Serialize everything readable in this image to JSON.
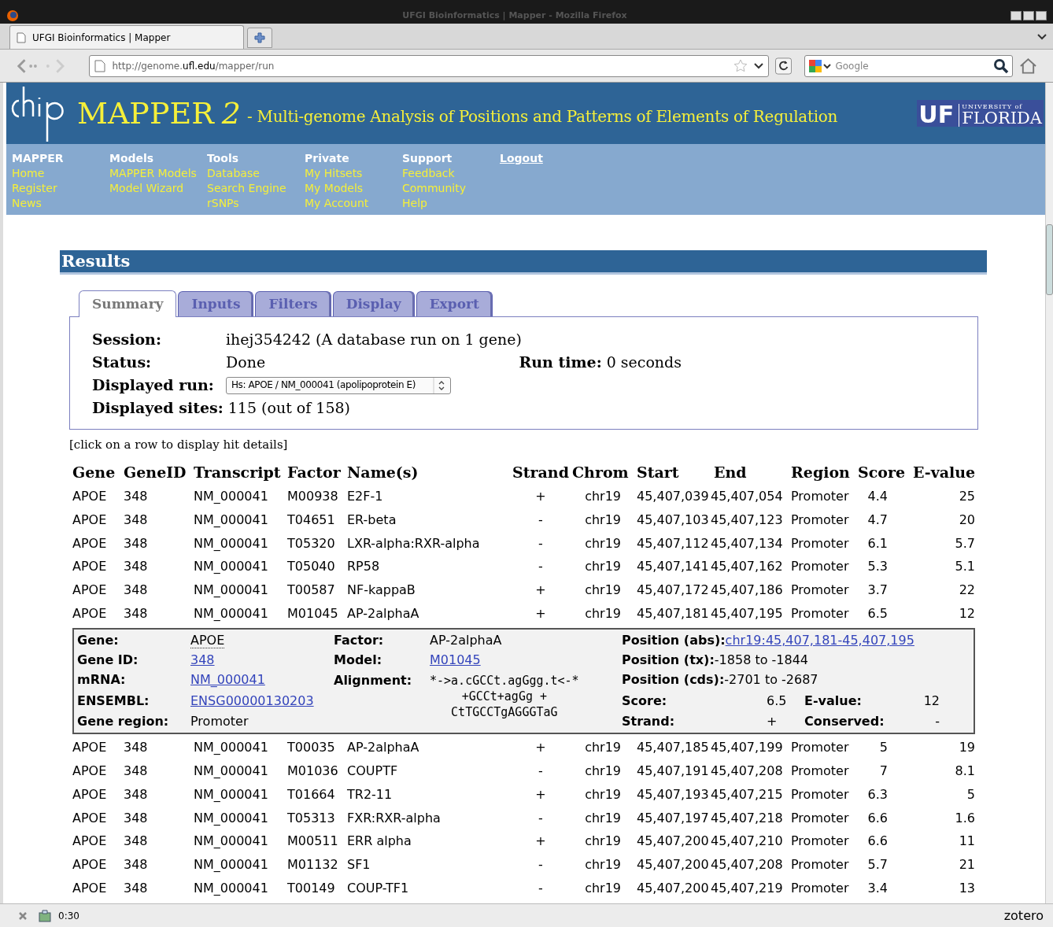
{
  "browser": {
    "window_title": "UFGI Bioinformatics | Mapper - Mozilla Firefox",
    "tab_title": "UFGI Bioinformatics | Mapper",
    "url_parts": [
      "http://genome.",
      "ufl.edu",
      "/mapper/run"
    ],
    "search_placeholder": "Google"
  },
  "header": {
    "title": "MAPPER",
    "version": "2",
    "subtitle": "- Multi-genome Analysis of Positions and Patterns of Elements of Regulation",
    "uf": "UF",
    "university": "UNIVERSITY of",
    "florida": "FLORIDA"
  },
  "menu": [
    {
      "heading": "MAPPER",
      "items": [
        "Home",
        "Register",
        "News"
      ]
    },
    {
      "heading": "Models",
      "items": [
        "MAPPER Models",
        "Model Wizard"
      ]
    },
    {
      "heading": "Tools",
      "items": [
        "Database",
        "Search Engine",
        "rSNPs"
      ]
    },
    {
      "heading": "Private",
      "items": [
        "My Hitsets",
        "My Models",
        "My Account"
      ]
    },
    {
      "heading": "Support",
      "items": [
        "Feedback",
        "Community",
        "Help"
      ]
    },
    {
      "heading": "Logout",
      "kind": "link"
    }
  ],
  "results": {
    "title": "Results",
    "tabs": [
      {
        "label": "Summary",
        "selected": true
      },
      {
        "label": "Inputs",
        "selected": false
      },
      {
        "label": "Filters",
        "selected": false
      },
      {
        "label": "Display",
        "selected": false
      },
      {
        "label": "Export",
        "selected": false
      }
    ],
    "session": {
      "label": "Session:",
      "value": "ihej354242 (A database run on 1 gene)"
    },
    "status": {
      "label": "Status:",
      "value": "Done"
    },
    "run_time": {
      "label": "Run time:",
      "value": "0 seconds"
    },
    "displayed_run": {
      "label": "Displayed run:",
      "value": "Hs: APOE / NM_000041 (apolipoprotein E)"
    },
    "displayed_sites": {
      "label": "Displayed sites:",
      "value": "115 (out of 158)"
    },
    "hint": "[click on a row to display hit details]",
    "table": {
      "columns": [
        "Gene",
        "GeneID",
        "Transcript",
        "Factor",
        "Name(s)",
        "Strand",
        "Chrom",
        "Start",
        "End",
        "Region",
        "Score",
        "E-value"
      ],
      "rows": [
        [
          "APOE",
          "348",
          "NM_000041",
          "M00938",
          "E2F-1",
          "+",
          "chr19",
          "45,407,039",
          "45,407,054",
          "Promoter",
          "4.4",
          "25"
        ],
        [
          "APOE",
          "348",
          "NM_000041",
          "T04651",
          "ER-beta",
          "-",
          "chr19",
          "45,407,103",
          "45,407,123",
          "Promoter",
          "4.7",
          "20"
        ],
        [
          "APOE",
          "348",
          "NM_000041",
          "T05320",
          "LXR-alpha:RXR-alpha",
          "-",
          "chr19",
          "45,407,112",
          "45,407,134",
          "Promoter",
          "6.1",
          "5.7"
        ],
        [
          "APOE",
          "348",
          "NM_000041",
          "T05040",
          "RP58",
          "-",
          "chr19",
          "45,407,141",
          "45,407,162",
          "Promoter",
          "5.3",
          "5.1"
        ],
        [
          "APOE",
          "348",
          "NM_000041",
          "T00587",
          "NF-kappaB",
          "+",
          "chr19",
          "45,407,172",
          "45,407,186",
          "Promoter",
          "3.7",
          "22"
        ],
        [
          "APOE",
          "348",
          "NM_000041",
          "M01045",
          "AP-2alphaA",
          "+",
          "chr19",
          "45,407,181",
          "45,407,195",
          "Promoter",
          "6.5",
          "12"
        ],
        [
          "APOE",
          "348",
          "NM_000041",
          "T00035",
          "AP-2alphaA",
          "+",
          "chr19",
          "45,407,185",
          "45,407,199",
          "Promoter",
          "5",
          "19"
        ],
        [
          "APOE",
          "348",
          "NM_000041",
          "M01036",
          "COUPTF",
          "-",
          "chr19",
          "45,407,191",
          "45,407,208",
          "Promoter",
          "7",
          "8.1"
        ],
        [
          "APOE",
          "348",
          "NM_000041",
          "T01664",
          "TR2-11",
          "+",
          "chr19",
          "45,407,193",
          "45,407,215",
          "Promoter",
          "6.3",
          "5"
        ],
        [
          "APOE",
          "348",
          "NM_000041",
          "T05313",
          "FXR:RXR-alpha",
          "-",
          "chr19",
          "45,407,197",
          "45,407,218",
          "Promoter",
          "6.6",
          "1.6"
        ],
        [
          "APOE",
          "348",
          "NM_000041",
          "M00511",
          "ERR alpha",
          "+",
          "chr19",
          "45,407,200",
          "45,407,210",
          "Promoter",
          "6.6",
          "11"
        ],
        [
          "APOE",
          "348",
          "NM_000041",
          "M01132",
          "SF1",
          "-",
          "chr19",
          "45,407,200",
          "45,407,208",
          "Promoter",
          "5.7",
          "21"
        ],
        [
          "APOE",
          "348",
          "NM_000041",
          "T00149",
          "COUP-TF1",
          "-",
          "chr19",
          "45,407,200",
          "45,407,219",
          "Promoter",
          "3.4",
          "13"
        ]
      ],
      "detail": [
        [
          {
            "label": "Gene:",
            "value": "APOE",
            "kind": "abbr"
          },
          {
            "label": "Gene ID:",
            "value": "348",
            "kind": "link"
          },
          {
            "label": "mRNA:",
            "value": "NM_000041",
            "kind": "link"
          },
          {
            "label": "ENSEMBL:",
            "value": "ENSG00000130203",
            "kind": "link"
          },
          {
            "label": "Gene region:",
            "value": "Promoter",
            "kind": "text"
          }
        ],
        [
          {
            "label": "Factor:",
            "value": "AP-2alphaA",
            "kind": "text"
          },
          {
            "label": "Model:",
            "value": "M01045",
            "kind": "link"
          },
          {
            "label": "Alignment:",
            "value": [
              "*->a.cGCCt.agGgg.t<-*",
              "+GCCt+agGg +",
              "CtTGCCTgAGGGTaG"
            ],
            "kind": "code"
          }
        ],
        [
          {
            "label": "Position (abs):",
            "value": "chr19:45,407,181-45,407,195",
            "kind": "link"
          },
          {
            "label": "Position (tx):",
            "value": "-1858 to -1844",
            "kind": "text"
          },
          {
            "label": "Position (cds):",
            "value": "-2701 to -2687",
            "kind": "text"
          },
          {
            "label": "Score:",
            "value": "6.5",
            "kind": "text"
          },
          {
            "label": "Strand:",
            "value": "+",
            "kind": "text"
          }
        ],
        [
          {
            "label": "E-value:",
            "value": "12",
            "kind": "text"
          },
          {
            "label": "Conserved:",
            "value": "-",
            "kind": "text"
          }
        ]
      ]
    }
  },
  "status_bar": {
    "time": "0:30",
    "addon": "zotero"
  }
}
